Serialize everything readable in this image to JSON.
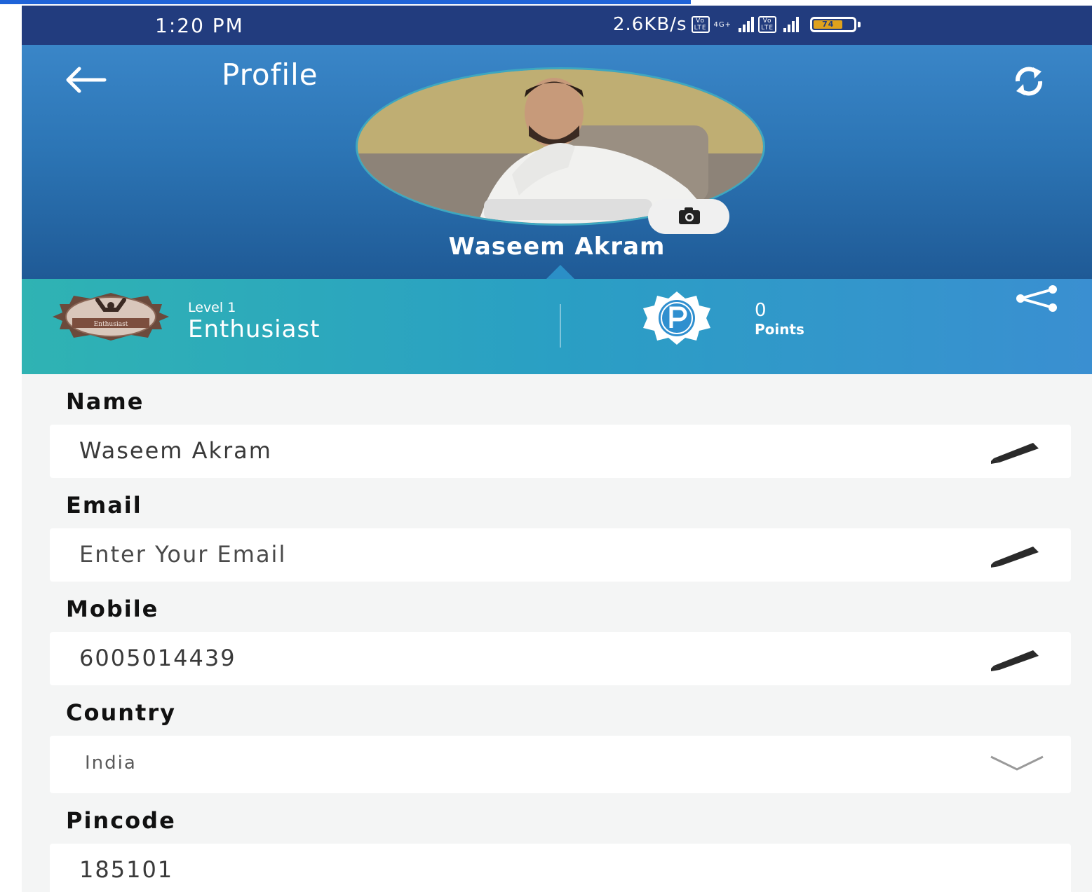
{
  "status_bar": {
    "time": "1:20 PM",
    "network_speed": "2.6KB/s",
    "sim_tag": "Vo LTE",
    "network_type": "4G+",
    "battery_level": 74,
    "battery_label": "74"
  },
  "header": {
    "title": "Profile",
    "user_name": "Waseem Akram"
  },
  "stats": {
    "badge_text": "Enthusiast",
    "level_label": "Level 1",
    "level_name": "Enthusiast",
    "points_value": "0",
    "points_label": "Points"
  },
  "form": {
    "name": {
      "label": "Name",
      "value": "Waseem Akram"
    },
    "email": {
      "label": "Email",
      "placeholder": "Enter Your Email"
    },
    "mobile": {
      "label": "Mobile",
      "value": "6005014439"
    },
    "country": {
      "label": "Country",
      "selected": "India"
    },
    "pincode": {
      "label": "Pincode",
      "value": "185101"
    }
  },
  "colors": {
    "status_bar": "#223c7e",
    "header_top": "#3a86c8",
    "header_bottom": "#1f5a96",
    "stats_left": "#2fb3b3",
    "stats_right": "#3a8fd1",
    "battery": "#e0a21c",
    "page_bg": "#f4f5f5"
  },
  "icons": {
    "back": "arrow-left-icon",
    "sync": "sync-icon",
    "camera": "camera-icon",
    "share": "share-icon",
    "edit": "pencil-icon",
    "dropdown": "chevron-down-icon",
    "badge": "enthusiast-badge-icon",
    "points": "points-p-icon"
  }
}
